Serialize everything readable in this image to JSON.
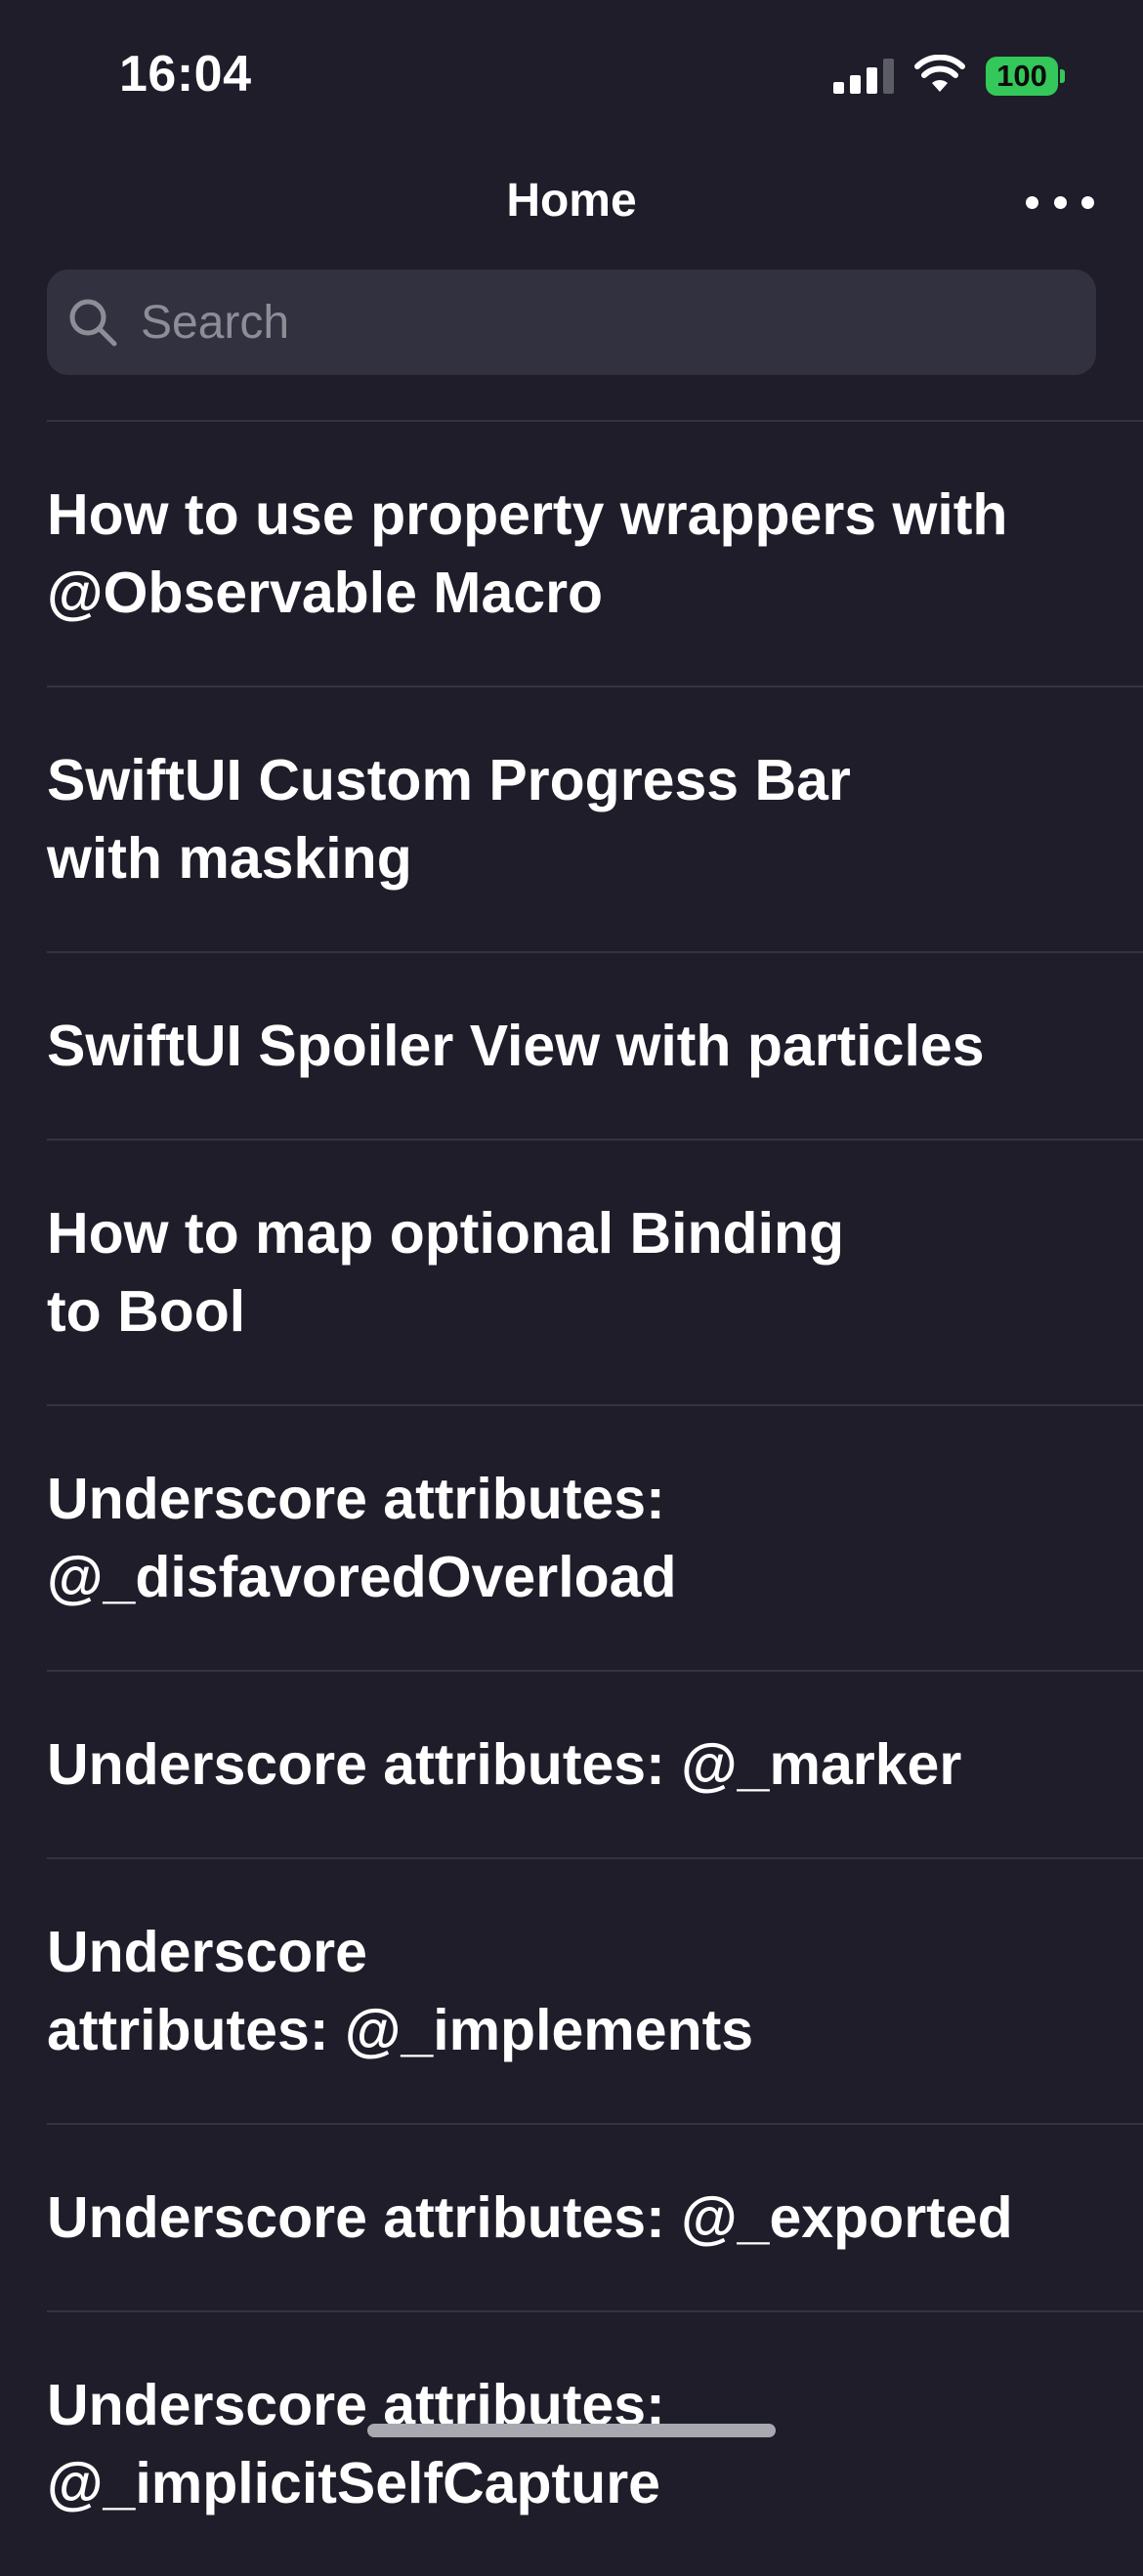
{
  "status_bar": {
    "time": "16:04",
    "battery": "100",
    "battery_color": "#34c759",
    "icons": [
      "signal-icon",
      "wifi-icon",
      "battery-icon"
    ]
  },
  "nav": {
    "title": "Home",
    "more_icon": "ellipsis-icon"
  },
  "search": {
    "placeholder": "Search",
    "icon": "search-icon"
  },
  "articles": [
    {
      "title": "How to use property wrappers with\n@Observable Macro"
    },
    {
      "title": "SwiftUI Custom Progress Bar\nwith masking"
    },
    {
      "title": "SwiftUI Spoiler View with particles"
    },
    {
      "title": "How to map optional Binding\nto Bool"
    },
    {
      "title": "Underscore attributes:\n@_disfavoredOverload"
    },
    {
      "title": "Underscore attributes: @_marker"
    },
    {
      "title": "Underscore\nattributes: @_implements"
    },
    {
      "title": "Underscore attributes: @_exported"
    },
    {
      "title": "Underscore attributes:\n@_implicitSelfCapture"
    }
  ],
  "colors": {
    "background": "#1e1d29",
    "search_field": "#313140",
    "separator": "#34333f"
  }
}
